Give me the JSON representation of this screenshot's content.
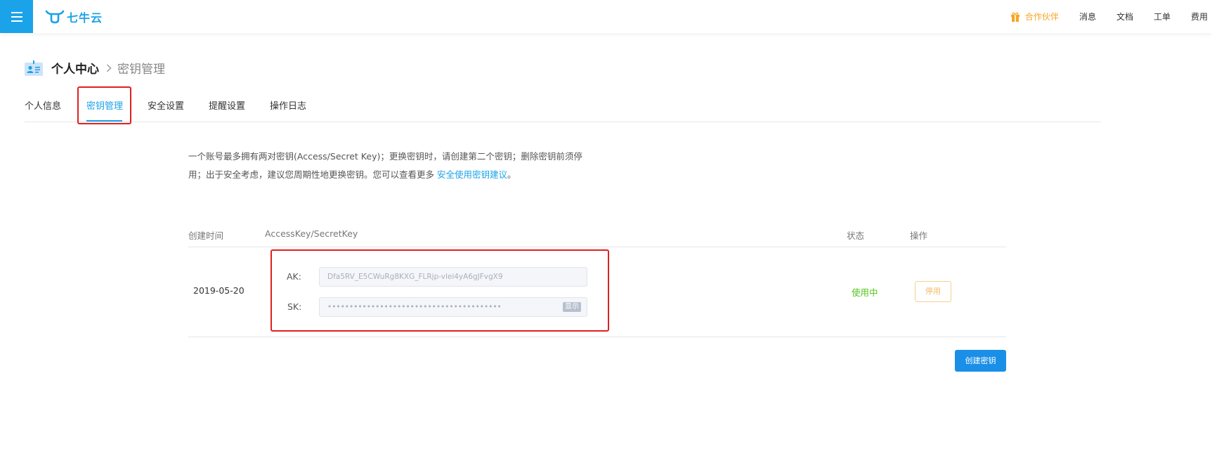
{
  "header": {
    "logo_text": "七牛云",
    "nav": {
      "partner": "合作伙伴",
      "messages": "消息",
      "docs": "文档",
      "tickets": "工单",
      "billing": "费用"
    }
  },
  "page": {
    "title": "个人中心",
    "subtitle": "密钥管理"
  },
  "tabs": [
    "个人信息",
    "密钥管理",
    "安全设置",
    "提醒设置",
    "操作日志"
  ],
  "active_tab": "密钥管理",
  "notice": {
    "text": "一个账号最多拥有两对密钥(Access/Secret Key)；更换密钥时，请创建第二个密钥；删除密钥前须停用；出于安全考虑，建议您周期性地更换密钥。您可以查看更多 ",
    "link_text": "安全使用密钥建议",
    "suffix": "。"
  },
  "table": {
    "headers": {
      "created": "创建时间",
      "keys": "AccessKey/SecretKey",
      "status": "状态",
      "actions": "操作"
    },
    "rows": [
      {
        "created": "2019-05-20",
        "ak_label": "AK:",
        "ak_value": "Dfa5RV_E5CWuRg8KXG_FLRjp-vlei4yA6gJFvgX9",
        "sk_label": "SK:",
        "sk_value": "••••••••••••••••••••••••••••••••••••••••",
        "show_label": "显示",
        "status": "使用中",
        "action": "停用"
      }
    ]
  },
  "create_button": "创建密钥",
  "colors": {
    "brand": "#1aa3e8",
    "success": "#52c41a",
    "warning": "#f5a623",
    "highlight": "#e02020"
  }
}
